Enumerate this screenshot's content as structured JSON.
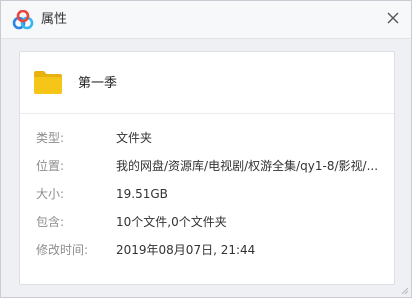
{
  "window": {
    "title": "属性",
    "close_icon": "close-icon",
    "app_icon": "baidu-netdisk-logo"
  },
  "file": {
    "icon": "folder-icon",
    "name": "第一季"
  },
  "properties": [
    {
      "label": "类型:",
      "value": "文件夹"
    },
    {
      "label": "位置:",
      "value": "我的网盘/资源库/电视剧/权游全集/qy1-8/影视/..."
    },
    {
      "label": "大小:",
      "value": "19.51GB"
    },
    {
      "label": "包含:",
      "value": "10个文件,0个文件夹"
    },
    {
      "label": "修改时间:",
      "value": "2019年08月07日, 21:44"
    }
  ],
  "colors": {
    "folder": "#f5c518",
    "logo_blue": "#2c83e6",
    "logo_cyan": "#35b7f0",
    "logo_red": "#e9463d"
  }
}
